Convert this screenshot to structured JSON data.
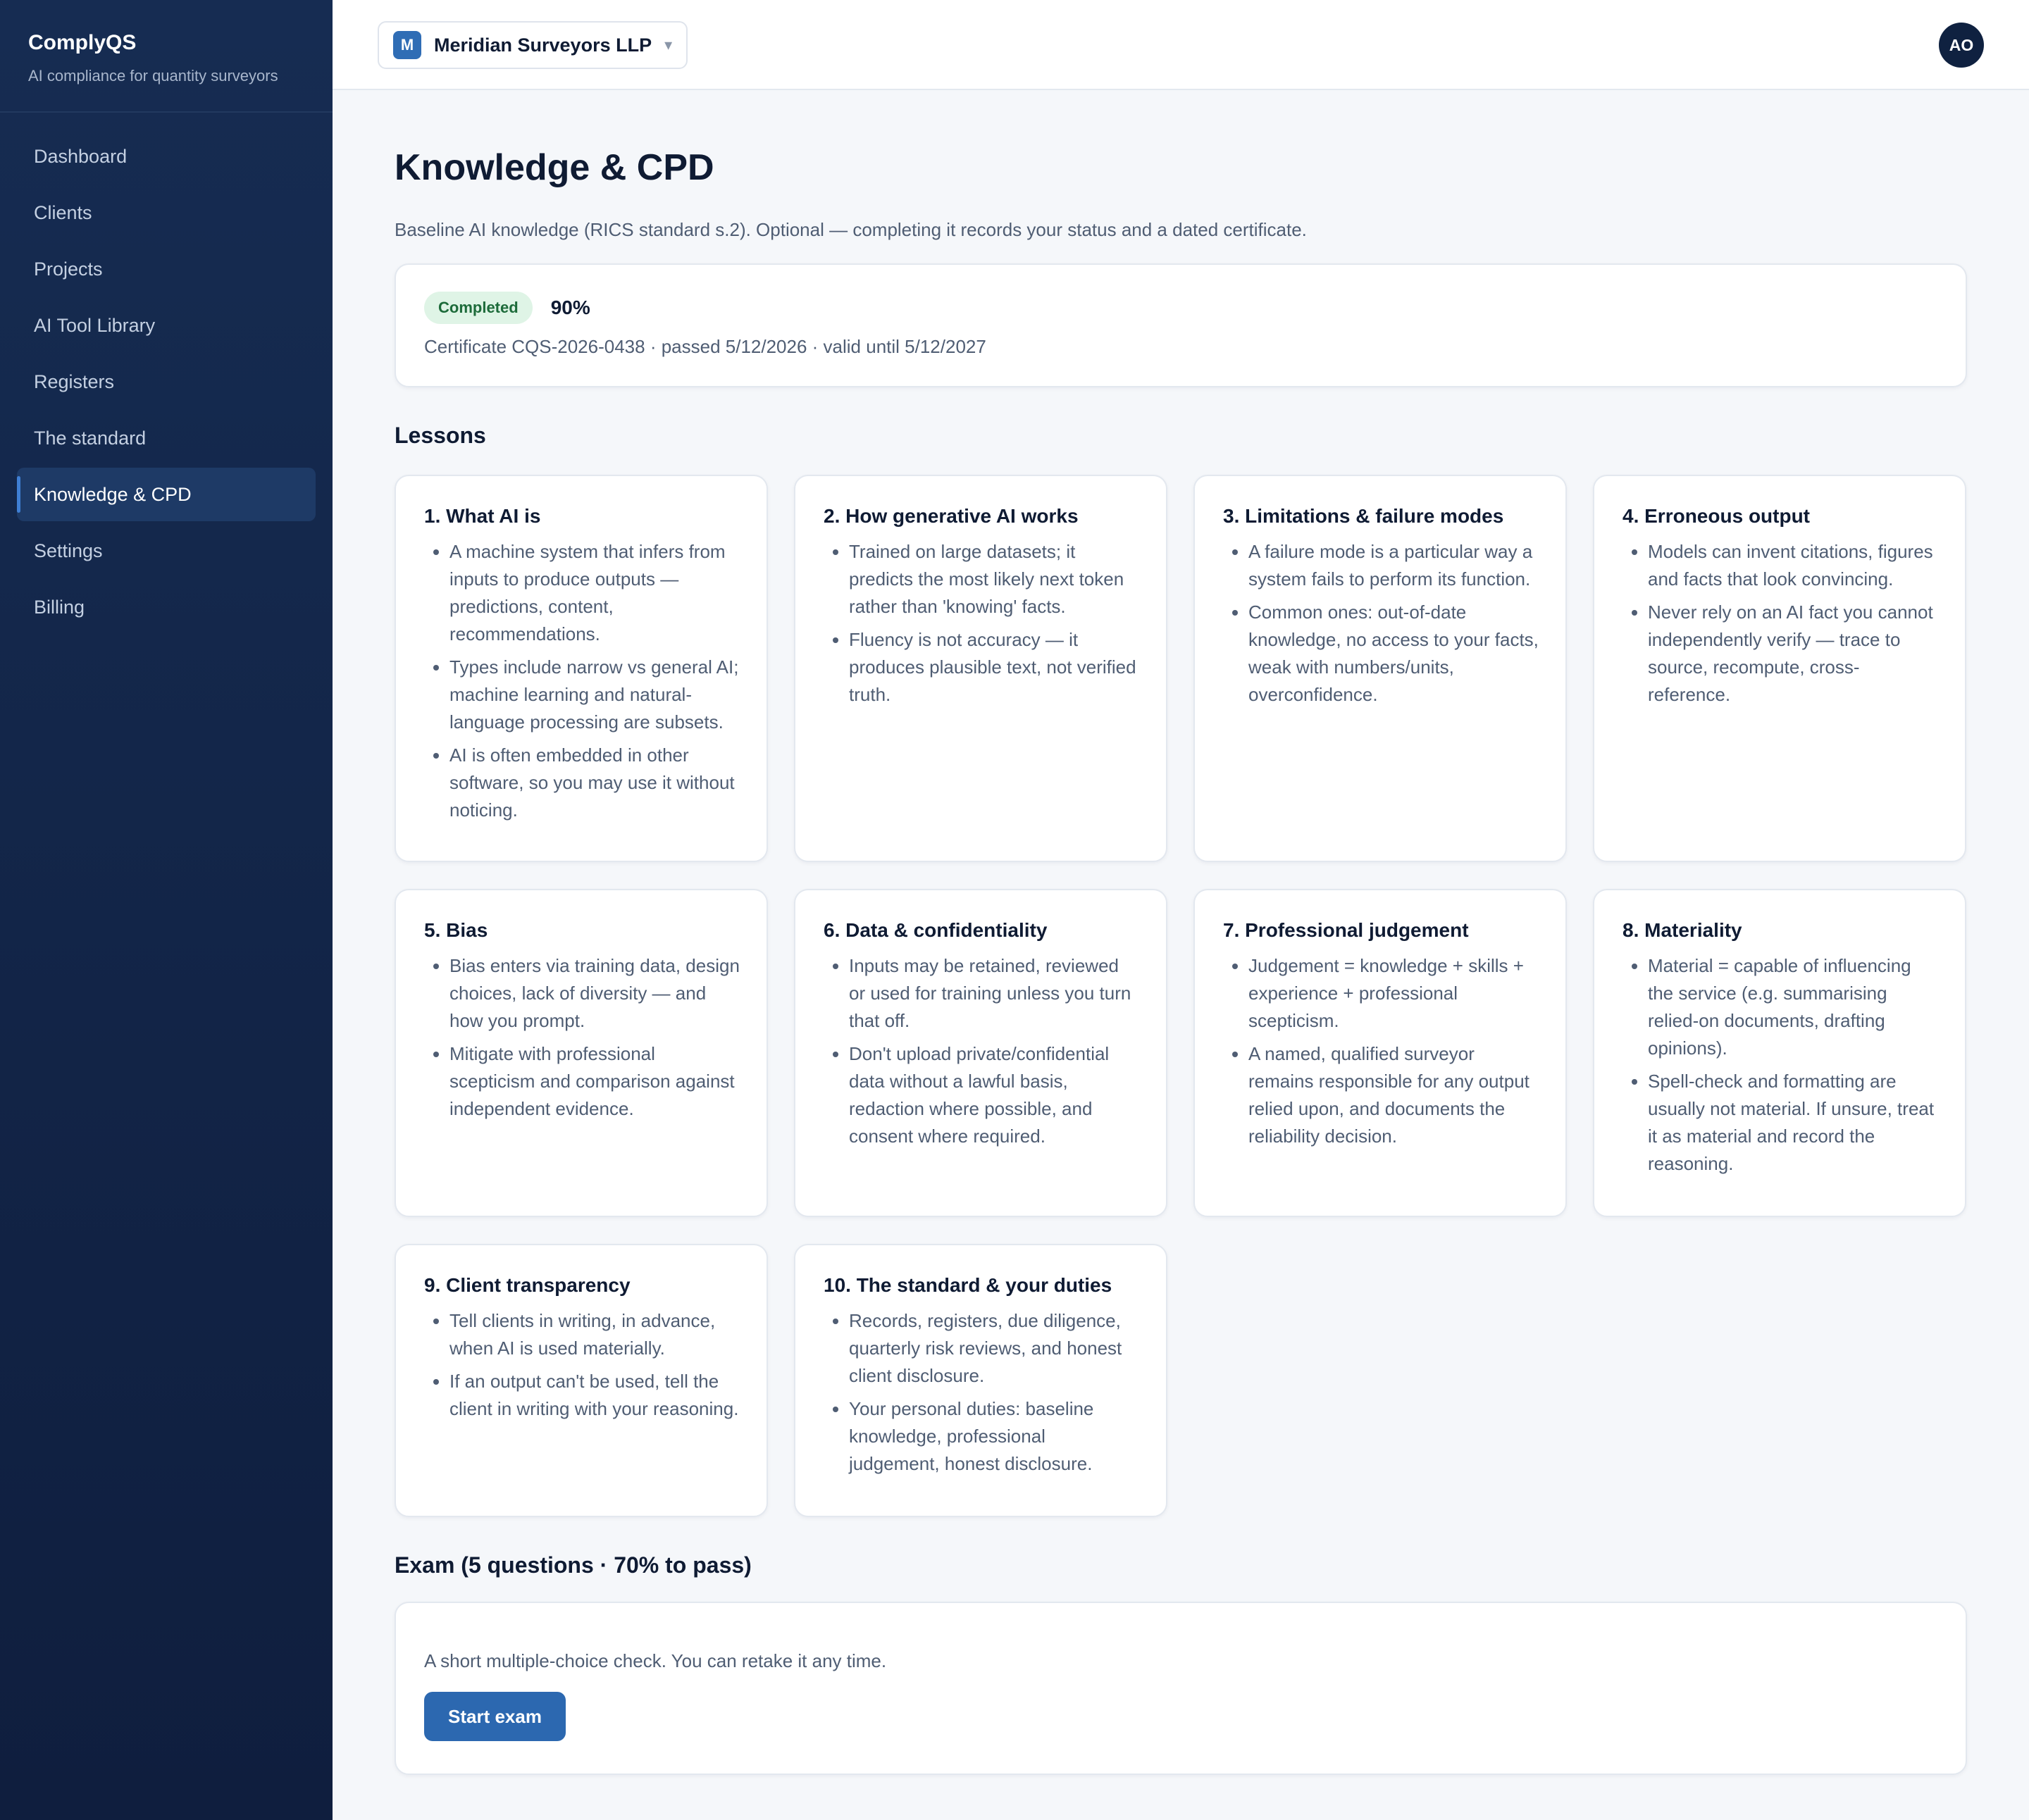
{
  "app": {
    "name": "ComplyQS",
    "tagline": "AI compliance for quantity surveyors"
  },
  "sidebar": {
    "items": [
      {
        "label": "Dashboard"
      },
      {
        "label": "Clients"
      },
      {
        "label": "Projects"
      },
      {
        "label": "AI Tool Library"
      },
      {
        "label": "Registers"
      },
      {
        "label": "The standard"
      },
      {
        "label": "Knowledge & CPD",
        "active": true
      },
      {
        "label": "Settings"
      },
      {
        "label": "Billing"
      }
    ]
  },
  "topbar": {
    "org_initial": "M",
    "org_name": "Meridian Surveyors LLP",
    "org_chevron": "▾",
    "user_initials": "AO"
  },
  "page": {
    "title": "Knowledge & CPD",
    "subtitle": "Baseline AI knowledge (RICS standard s.2). Optional — completing it records your status and a dated certificate."
  },
  "status": {
    "badge": "Completed",
    "score": "90%",
    "certificate": "Certificate CQS-2026-0438 · passed 5/12/2026 · valid until 5/12/2027"
  },
  "lessons": {
    "title": "Lessons",
    "items": [
      {
        "title": "1. What AI is",
        "points": [
          "A machine system that infers from inputs to produce outputs — predictions, content, recommendations.",
          "Types include narrow vs general AI; machine learning and natural-language processing are subsets.",
          "AI is often embedded in other software, so you may use it without noticing."
        ]
      },
      {
        "title": "2. How generative AI works",
        "points": [
          "Trained on large datasets; it predicts the most likely next token rather than 'knowing' facts.",
          "Fluency is not accuracy — it produces plausible text, not verified truth."
        ]
      },
      {
        "title": "3. Limitations & failure modes",
        "points": [
          "A failure mode is a particular way a system fails to perform its function.",
          "Common ones: out-of-date knowledge, no access to your facts, weak with numbers/units, overconfidence."
        ]
      },
      {
        "title": "4. Erroneous output",
        "points": [
          "Models can invent citations, figures and facts that look convincing.",
          "Never rely on an AI fact you cannot independently verify — trace to source, recompute, cross-reference."
        ]
      },
      {
        "title": "5. Bias",
        "points": [
          "Bias enters via training data, design choices, lack of diversity — and how you prompt.",
          "Mitigate with professional scepticism and comparison against independent evidence."
        ]
      },
      {
        "title": "6. Data & confidentiality",
        "points": [
          "Inputs may be retained, reviewed or used for training unless you turn that off.",
          "Don't upload private/confidential data without a lawful basis, redaction where possible, and consent where required."
        ]
      },
      {
        "title": "7. Professional judgement",
        "points": [
          "Judgement = knowledge + skills + experience + professional scepticism.",
          "A named, qualified surveyor remains responsible for any output relied upon, and documents the reliability decision."
        ]
      },
      {
        "title": "8. Materiality",
        "points": [
          "Material = capable of influencing the service (e.g. summarising relied-on documents, drafting opinions).",
          "Spell-check and formatting are usually not material. If unsure, treat it as material and record the reasoning."
        ]
      },
      {
        "title": "9. Client transparency",
        "points": [
          "Tell clients in writing, in advance, when AI is used materially.",
          "If an output can't be used, tell the client in writing with your reasoning."
        ]
      },
      {
        "title": "10. The standard & your duties",
        "points": [
          "Records, registers, due diligence, quarterly risk reviews, and honest client disclosure.",
          "Your personal duties: baseline knowledge, professional judgement, honest disclosure."
        ]
      }
    ]
  },
  "exam": {
    "title": "Exam (5 questions · 70% to pass)",
    "description": "A short multiple-choice check. You can retake it any time.",
    "button": "Start exam"
  },
  "colors": {
    "sidebar_bg": "#132748",
    "accent": "#2c68b0",
    "success_bg": "#dff4e6",
    "success_text": "#1d6b3a"
  }
}
